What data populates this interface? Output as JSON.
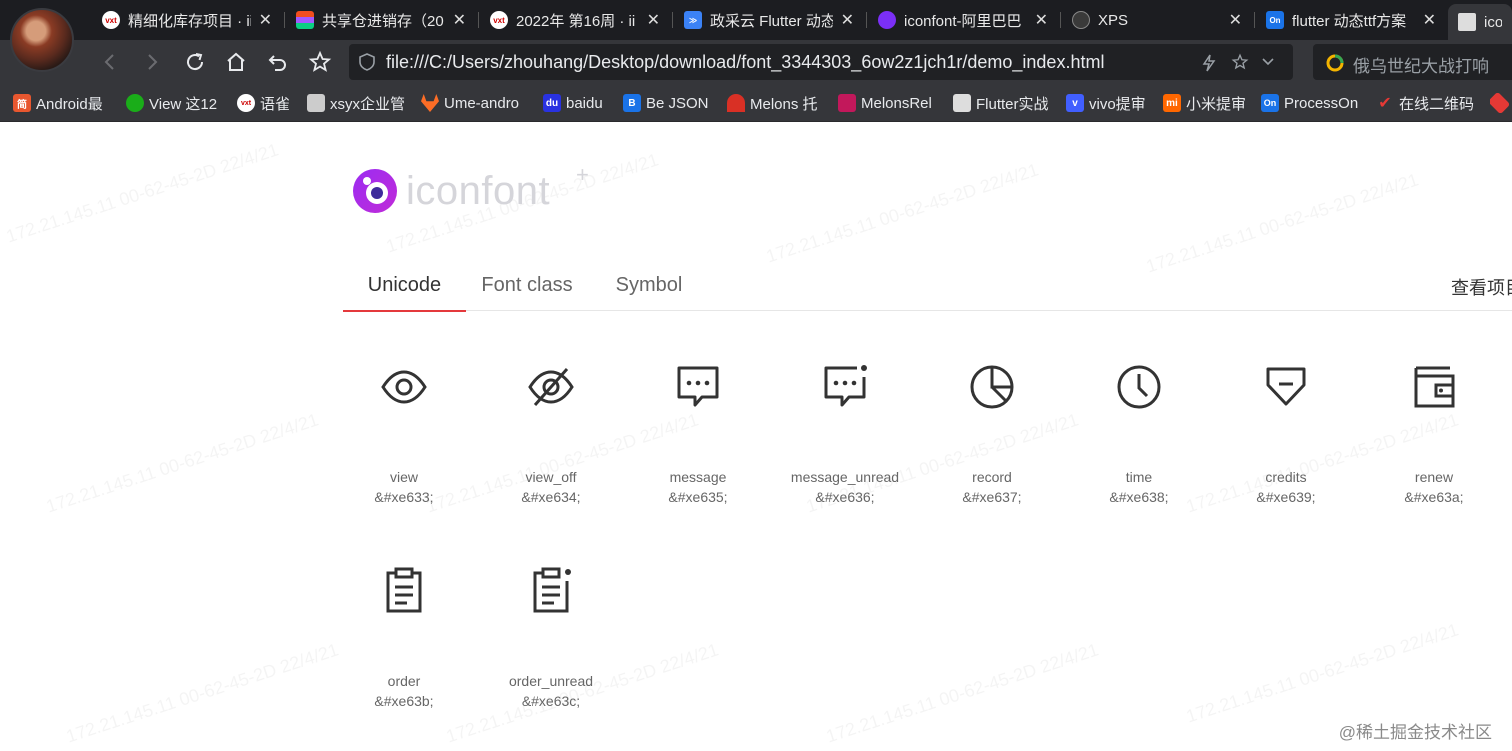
{
  "browser": {
    "tabs": [
      {
        "title": "精细化库存项目 · ii",
        "icon": "vxt-icon",
        "color": "#ffffff"
      },
      {
        "title": "共享仓进销存（20",
        "icon": "figma-icon",
        "color": "#f24e1e"
      },
      {
        "title": "2022年 第16周 · ii",
        "icon": "vxt-icon",
        "color": "#ffffff"
      },
      {
        "title": "政采云 Flutter 动态",
        "icon": "zcy-icon",
        "color": "#3b82f6"
      },
      {
        "title": "iconfont-阿里巴巴",
        "icon": "iconfont-icon",
        "color": "#7b2ff7"
      },
      {
        "title": "XPS",
        "icon": "xps-icon",
        "color": "#777777"
      },
      {
        "title": "flutter 动态ttf方案",
        "icon": "processon-icon",
        "color": "#1a73e8"
      },
      {
        "title": "icon",
        "icon": "page-icon",
        "color": "#dddddd"
      }
    ],
    "url": "file:///C:/Users/zhouhang/Desktop/download/font_3344303_6ow2z1jch1r/demo_index.html",
    "search_text": "俄乌世纪大战打响",
    "bookmarks": [
      {
        "label": "Android最",
        "icon": "jian-icon",
        "color": "#e8572f"
      },
      {
        "label": "View 这12",
        "icon": "wechat-icon",
        "color": "#1aad19"
      },
      {
        "label": "语雀",
        "icon": "vxt-icon",
        "color": "#ffffff"
      },
      {
        "label": "xsyx企业管",
        "icon": "doc-icon",
        "color": "#cccccc"
      },
      {
        "label": "Ume-andro",
        "icon": "gitlab-icon",
        "color": "#fc6d26"
      },
      {
        "label": "baidu",
        "icon": "baidu-icon",
        "color": "#2932e1"
      },
      {
        "label": "Be JSON",
        "icon": "bejson-icon",
        "color": "#1a73e8"
      },
      {
        "label": "Melons 托",
        "icon": "melons-icon",
        "color": "#d93025"
      },
      {
        "label": "MelonsRel",
        "icon": "melonsrel-icon",
        "color": "#c2185b"
      },
      {
        "label": "Flutter实战",
        "icon": "book-icon",
        "color": "#dddddd"
      },
      {
        "label": "vivo提审",
        "icon": "vivo-icon",
        "color": "#415fff"
      },
      {
        "label": "小米提审",
        "icon": "mi-icon",
        "color": "#ff6700"
      },
      {
        "label": "ProcessOn",
        "icon": "processon-icon",
        "color": "#1a73e8"
      },
      {
        "label": "在线二维码",
        "icon": "check-icon",
        "color": "#e53935"
      }
    ]
  },
  "page": {
    "logo_text": "iconfont",
    "logo_plus": "+",
    "tabs": [
      "Unicode",
      "Font class",
      "Symbol"
    ],
    "view_project": "查看项目",
    "accent": "#e4393c",
    "icons": [
      {
        "name": "view",
        "code": "&#xe633;",
        "icon": "eye-icon"
      },
      {
        "name": "view_off",
        "code": "&#xe634;",
        "icon": "eye-off-icon"
      },
      {
        "name": "message",
        "code": "&#xe635;",
        "icon": "message-icon"
      },
      {
        "name": "message_unread",
        "code": "&#xe636;",
        "icon": "message-unread-icon"
      },
      {
        "name": "record",
        "code": "&#xe637;",
        "icon": "pie-chart-icon"
      },
      {
        "name": "time",
        "code": "&#xe638;",
        "icon": "clock-icon"
      },
      {
        "name": "credits",
        "code": "&#xe639;",
        "icon": "diamond-icon"
      },
      {
        "name": "renew",
        "code": "&#xe63a;",
        "icon": "wallet-icon"
      },
      {
        "name": "order",
        "code": "&#xe63b;",
        "icon": "clipboard-icon"
      },
      {
        "name": "order_unread",
        "code": "&#xe63c;",
        "icon": "clipboard-unread-icon"
      }
    ],
    "site_watermark": "@稀土掘金技术社区",
    "background_watermark": "172.21.145.11 00-62-45-2D 22/4/21"
  }
}
